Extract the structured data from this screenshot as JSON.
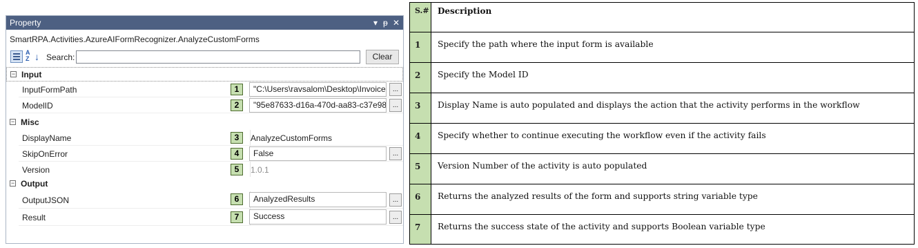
{
  "panel": {
    "title": "Property",
    "title_icons": [
      "dropdown-arrow-icon",
      "pin-icon",
      "close-icon"
    ],
    "pin_glyph": "ᵽ",
    "dropdown_glyph": "▾",
    "close_glyph": "✕",
    "activity_name": "SmartRPA.Activities.AzureAIFormRecognizer.AnalyzeCustomForms",
    "toolbar": {
      "sort_alpha_top": "A",
      "sort_alpha_bottom": "Z",
      "search_label": "Search:",
      "search_value": "",
      "clear_label": "Clear"
    },
    "categories": [
      {
        "label": "Input",
        "collapse_glyph": "−",
        "properties": [
          {
            "name": "InputFormPath",
            "badge": "1",
            "value": "\"C:\\Users\\ravsalom\\Desktop\\Invoice",
            "has_button": true
          },
          {
            "name": "ModelID",
            "badge": "2",
            "value": "\"95e87633-d16a-470d-aa83-c37e98",
            "has_button": true
          }
        ]
      },
      {
        "label": "Misc",
        "collapse_glyph": "−",
        "properties": [
          {
            "name": "DisplayName",
            "badge": "3",
            "value": "AnalyzeCustomForms",
            "has_button": false
          },
          {
            "name": "SkipOnError",
            "badge": "4",
            "value": "False",
            "has_button": true
          },
          {
            "name": "Version",
            "badge": "5",
            "value": "1.0.1",
            "has_button": false
          }
        ]
      },
      {
        "label": "Output",
        "collapse_glyph": "−",
        "properties": [
          {
            "name": "OutputJSON",
            "badge": "6",
            "value": "AnalyzedResults",
            "has_button": true
          },
          {
            "name": "Result",
            "badge": "7",
            "value": "Success",
            "has_button": true
          }
        ]
      }
    ],
    "ellipsis_label": "..."
  },
  "table": {
    "header": {
      "num": "S.#",
      "desc": "Description"
    },
    "rows": [
      {
        "num": "1",
        "desc": "Specify the path where the input form is available"
      },
      {
        "num": "2",
        "desc": "Specify the Model ID"
      },
      {
        "num": "3",
        "desc": "Display Name is auto populated and displays the action that the activity performs in the workflow"
      },
      {
        "num": "4",
        "desc": "Specify whether to continue executing the workflow even if the activity fails"
      },
      {
        "num": "5",
        "desc": "Version Number of the activity is auto populated"
      },
      {
        "num": "6",
        "desc": "Returns the analyzed results of the form and supports string variable type"
      },
      {
        "num": "7",
        "desc": "Returns the success state of the activity and supports Boolean variable type"
      }
    ]
  },
  "colors": {
    "titlebar": "#4d6082",
    "badge_fill": "#c6dfb0",
    "badge_border": "#4d6b2e",
    "table_num_fill": "#c6dfb0"
  }
}
